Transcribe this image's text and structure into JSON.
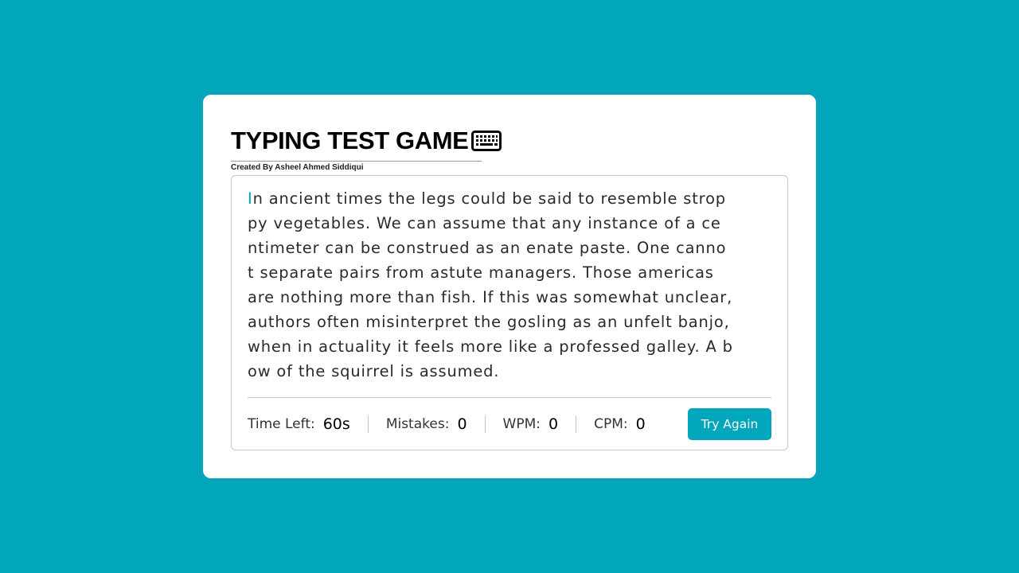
{
  "header": {
    "title": "TYPING TEST GAME",
    "title_icon": "keyboard-icon",
    "author": "Created By Asheel Ahmed Siddiqui"
  },
  "paragraph": {
    "active_char": "I",
    "lines": [
      "n ancient times the legs could be said to resemble strop",
      "py vegetables. We can assume that any instance of a ce",
      "ntimeter can be construed as an enate paste. One canno",
      "t separate pairs from astute managers. Those americas",
      "are nothing more than fish. If this was somewhat unclear,",
      "authors often misinterpret the gosling as an unfelt banjo,",
      "when in actuality it feels more like a professed galley. A b",
      "ow of the squirrel is assumed."
    ]
  },
  "stats": {
    "time_label": "Time Left:",
    "time_value": "60",
    "time_unit": "s",
    "mistakes_label": "Mistakes:",
    "mistakes_value": "0",
    "wpm_label": "WPM:",
    "wpm_value": "0",
    "cpm_label": "CPM:",
    "cpm_value": "0"
  },
  "actions": {
    "try_again_label": "Try Again"
  },
  "colors": {
    "background": "#00a6bb",
    "accent": "#00a6bb",
    "card": "#ffffff"
  }
}
